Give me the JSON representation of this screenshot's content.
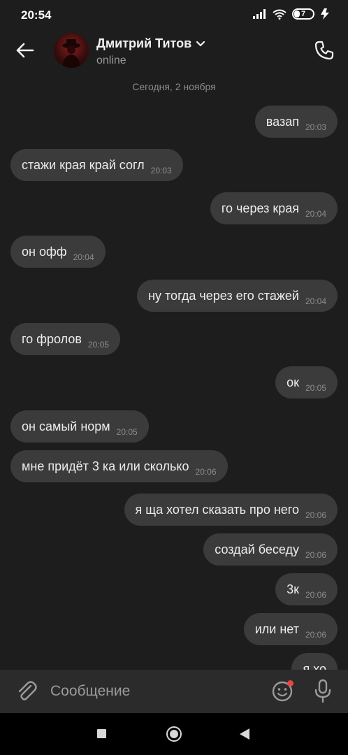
{
  "status_bar": {
    "time": "20:54",
    "battery": "7"
  },
  "header": {
    "contact_name": "Дмитрий Титов",
    "status": "online"
  },
  "chat": {
    "date": "Сегодня, 2 ноября",
    "messages": [
      {
        "dir": "out",
        "text": "вазап",
        "time": "20:03"
      },
      {
        "dir": "in",
        "text": "стажи края край согл",
        "time": "20:03"
      },
      {
        "dir": "out",
        "text": "го через края",
        "time": "20:04"
      },
      {
        "dir": "in",
        "text": "он офф",
        "time": "20:04"
      },
      {
        "dir": "out",
        "text": "ну тогда через его стажей",
        "time": "20:04"
      },
      {
        "dir": "in",
        "text": "го фролов",
        "time": "20:05"
      },
      {
        "dir": "out",
        "text": "ок",
        "time": "20:05"
      },
      {
        "dir": "in",
        "text": "он самый норм",
        "time": "20:05"
      },
      {
        "dir": "in",
        "text": "мне придёт 3 ка или сколько",
        "time": "20:06"
      },
      {
        "dir": "out",
        "text": "я ща хотел сказать про него",
        "time": "20:06"
      },
      {
        "dir": "out",
        "text": "создай беседу",
        "time": "20:06"
      },
      {
        "dir": "out",
        "text": "3к",
        "time": "20:06"
      },
      {
        "dir": "out",
        "text": "или нет",
        "time": "20:06"
      },
      {
        "dir": "out",
        "text": "я хо",
        "time": ""
      }
    ]
  },
  "composer": {
    "placeholder": "Сообщение"
  },
  "icons": {
    "back": "arrow-left-icon",
    "chevron": "chevron-down-icon",
    "call": "phone-icon",
    "attach": "paperclip-icon",
    "sticker": "smiley-icon",
    "mic": "microphone-icon"
  },
  "colors": {
    "background": "#1d1d1d",
    "bubble": "#3b3b3b",
    "composer": "#2b2b2b",
    "notification_dot": "#e64646"
  }
}
